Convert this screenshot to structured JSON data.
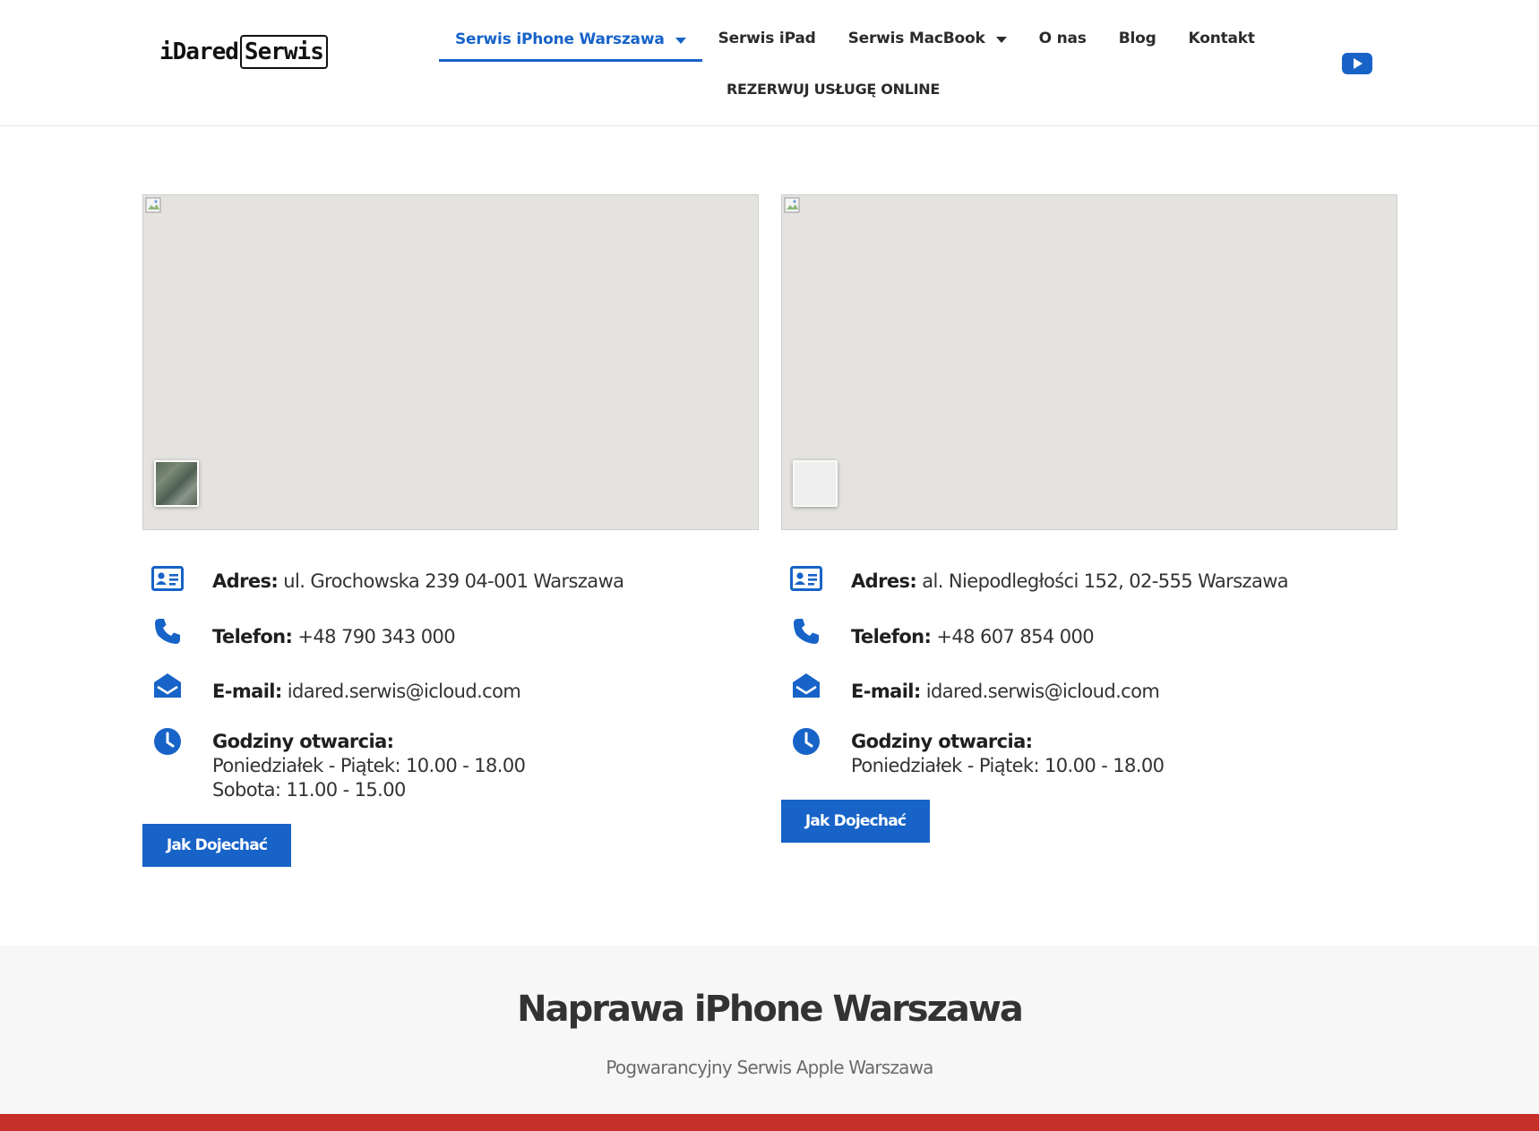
{
  "brand": {
    "logo_left": "iDared",
    "logo_right": "Serwis"
  },
  "nav": {
    "items": [
      {
        "label": "Serwis iPhone Warszawa",
        "dropdown": true,
        "active": true
      },
      {
        "label": "Serwis iPad",
        "dropdown": false,
        "active": false
      },
      {
        "label": "Serwis MacBook",
        "dropdown": true,
        "active": false
      },
      {
        "label": "O nas",
        "dropdown": false,
        "active": false
      },
      {
        "label": "Blog",
        "dropdown": false,
        "active": false
      },
      {
        "label": "Kontakt",
        "dropdown": false,
        "active": false
      }
    ],
    "cta": "REZERWUJ USŁUGĘ ONLINE",
    "social_icon": "youtube-icon"
  },
  "colors": {
    "accent": "#1763c8",
    "footer_bar": "#c62f2a",
    "band_bg": "#f7f7f7",
    "map_bg": "#e5e3df"
  },
  "locations": [
    {
      "address_label": "Adres:",
      "address": "ul. Grochowska 239 04-001 Warszawa",
      "phone_label": "Telefon:",
      "phone": "+48 790 343 000",
      "email_label": "E-mail:",
      "email": "idared.serwis@icloud.com",
      "hours_label": "Godziny otwarcia:",
      "hours": [
        "Poniedziałek - Piątek: 10.00 - 18.00",
        "Sobota: 11.00 - 15.00"
      ],
      "button": "Jak Dojechać"
    },
    {
      "address_label": "Adres:",
      "address": "al. Niepodległości 152, 02-555 Warszawa",
      "phone_label": "Telefon:",
      "phone": "+48 607 854 000",
      "email_label": "E-mail:",
      "email": "idared.serwis@icloud.com",
      "hours_label": "Godziny otwarcia:",
      "hours": [
        "Poniedziałek - Piątek: 10.00 - 18.00"
      ],
      "button": "Jak Dojechać"
    }
  ],
  "section": {
    "title": "Naprawa iPhone Warszawa",
    "subtitle": "Pogwarancyjny Serwis Apple Warszawa"
  }
}
